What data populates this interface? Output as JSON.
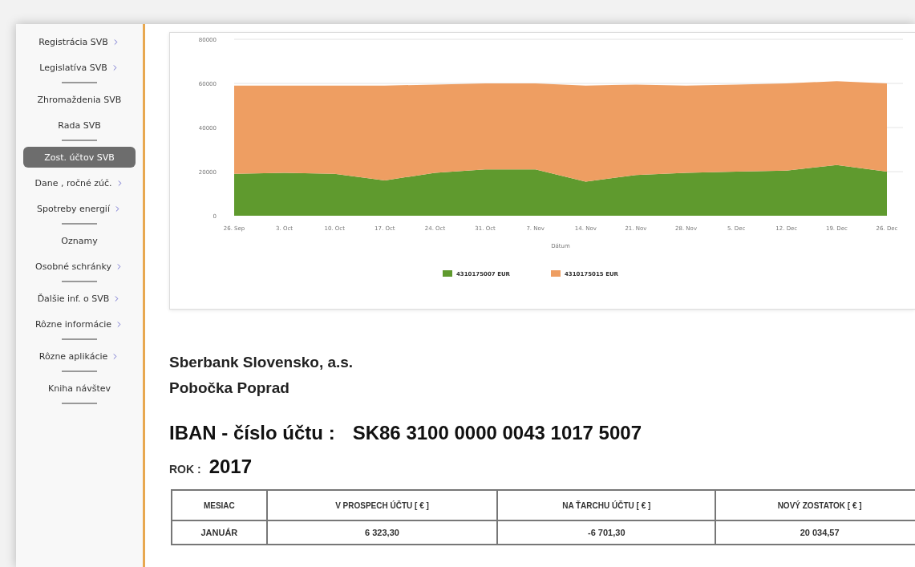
{
  "sidebar": {
    "items": [
      {
        "label": "Registrácia SVB",
        "submenu": true,
        "selected": false,
        "divider_after": false
      },
      {
        "label": "Legislatíva SVB",
        "submenu": true,
        "selected": false,
        "divider_after": true
      },
      {
        "label": "Zhromaždenia SVB",
        "submenu": false,
        "selected": false,
        "divider_after": false
      },
      {
        "label": "Rada SVB",
        "submenu": false,
        "selected": false,
        "divider_after": true
      },
      {
        "label": "Zost. účtov SVB",
        "submenu": false,
        "selected": true,
        "divider_after": false
      },
      {
        "label": "Dane , ročné zúč.",
        "submenu": true,
        "selected": false,
        "divider_after": false
      },
      {
        "label": "Spotreby energií",
        "submenu": true,
        "selected": false,
        "divider_after": true
      },
      {
        "label": "Oznamy",
        "submenu": false,
        "selected": false,
        "divider_after": false
      },
      {
        "label": "Osobné schránky",
        "submenu": true,
        "selected": false,
        "divider_after": true
      },
      {
        "label": "Ďalšie inf. o SVB",
        "submenu": true,
        "selected": false,
        "divider_after": false
      },
      {
        "label": "Rôzne informácie",
        "submenu": true,
        "selected": false,
        "divider_after": true
      },
      {
        "label": "Rôzne aplikácie",
        "submenu": true,
        "selected": false,
        "divider_after": true
      },
      {
        "label": "Kniha návštev",
        "submenu": false,
        "selected": false,
        "divider_after": true
      }
    ]
  },
  "chart": {
    "chart_data": {
      "type": "area",
      "stacked": true,
      "grid": true,
      "legend": true,
      "xlabel": "Dátum",
      "categories": [
        "26. Sep",
        "3. Oct",
        "10. Oct",
        "17. Oct",
        "24. Oct",
        "31. Oct",
        "7. Nov",
        "14. Nov",
        "21. Nov",
        "28. Nov",
        "5. Dec",
        "12. Dec",
        "19. Dec",
        "26. Dec"
      ],
      "ylim": [
        0,
        80000
      ],
      "yticks": [
        0,
        20000,
        40000,
        60000,
        80000
      ],
      "series": [
        {
          "name": "4310175007 EUR",
          "color": "#5f9a2e",
          "values": [
            19000,
            19500,
            19000,
            16000,
            19500,
            21000,
            21000,
            15500,
            18500,
            19500,
            20000,
            20500,
            23000,
            20000
          ]
        },
        {
          "name": "4310175015 EUR",
          "color": "#ee9e62",
          "values": [
            40000,
            39500,
            40000,
            43000,
            40000,
            39000,
            39000,
            43500,
            41000,
            39500,
            39500,
            39500,
            38000,
            40000
          ]
        }
      ]
    }
  },
  "bank": {
    "name": "Sberbank Slovensko, a.s.",
    "branch": "Pobočka Poprad"
  },
  "iban": {
    "label": "IBAN - číslo účtu  :",
    "value": "SK86 3100 0000 0043 1017 5007"
  },
  "year": {
    "label": "ROK :",
    "value": "2017"
  },
  "table": {
    "columns": [
      "MESIAC",
      "V PROSPECH ÚČTU [ € ]",
      "NA ŤARCHU ÚČTU [ € ]",
      "NOVÝ ZOSTATOK [ € ]"
    ],
    "rows": [
      [
        "JANUÁR",
        "6 323,30",
        "-6 701,30",
        "20 034,57"
      ]
    ]
  }
}
